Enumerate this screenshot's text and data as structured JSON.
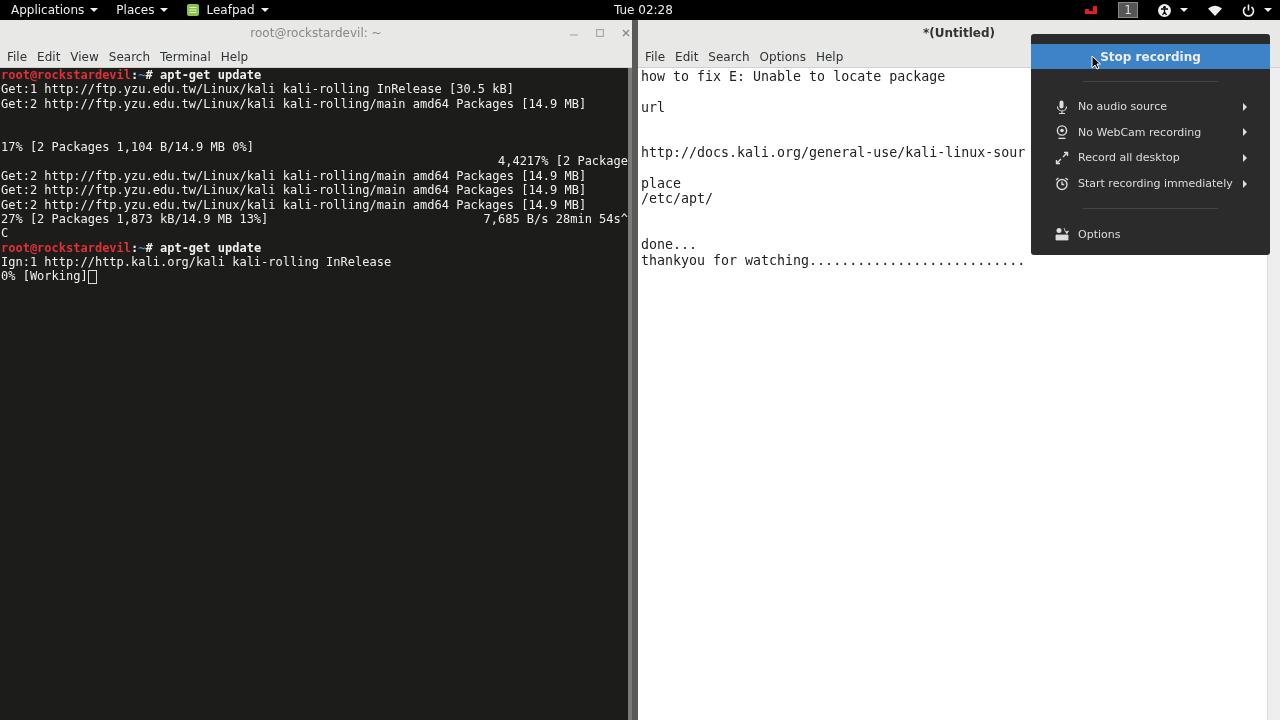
{
  "top_bar": {
    "menus": [
      {
        "label": "Applications",
        "kind": "plain"
      },
      {
        "label": "Places",
        "kind": "plain"
      },
      {
        "label": "Leafpad",
        "kind": "app"
      }
    ],
    "clock": "Tue 02:28",
    "workspace": "1"
  },
  "terminal": {
    "title": "root@rockstardevil: ~",
    "menu": [
      "File",
      "Edit",
      "View",
      "Search",
      "Terminal",
      "Help"
    ],
    "lines": [
      {
        "kind": "prompt",
        "user": "root@rockstardevil",
        "sep": ":",
        "path": "~",
        "command": "# apt-get update"
      },
      {
        "kind": "text",
        "text": "Get:1 http://ftp.yzu.edu.tw/Linux/kali kali-rolling InRelease [30.5 kB]"
      },
      {
        "kind": "text",
        "text": "Get:2 http://ftp.yzu.edu.tw/Linux/kali kali-rolling/main amd64 Packages [14.9 MB]"
      },
      {
        "kind": "blank"
      },
      {
        "kind": "blank"
      },
      {
        "kind": "text",
        "text": "17% [2 Packages 1,104 B/14.9 MB 0%]"
      },
      {
        "kind": "right",
        "text": "4,4217% [2 Package"
      },
      {
        "kind": "text",
        "text": "Get:2 http://ftp.yzu.edu.tw/Linux/kali kali-rolling/main amd64 Packages [14.9 MB]"
      },
      {
        "kind": "text",
        "text": "Get:2 http://ftp.yzu.edu.tw/Linux/kali kali-rolling/main amd64 Packages [14.9 MB]"
      },
      {
        "kind": "text",
        "text": "Get:2 http://ftp.yzu.edu.tw/Linux/kali kali-rolling/main amd64 Packages [14.9 MB]"
      },
      {
        "kind": "split",
        "left": "27% [2 Packages 1,873 kB/14.9 MB 13%]",
        "right": "7,685 B/s 28min 54s^"
      },
      {
        "kind": "text",
        "text": "C"
      },
      {
        "kind": "prompt",
        "user": "root@rockstardevil",
        "sep": ":",
        "path": "~",
        "command": "# apt-get update"
      },
      {
        "kind": "text",
        "text": "Ign:1 http://http.kali.org/kali kali-rolling InRelease"
      },
      {
        "kind": "cursor",
        "text": "0% [Working]"
      }
    ]
  },
  "leafpad": {
    "title": "*(Untitled)",
    "menu": [
      "File",
      "Edit",
      "Search",
      "Options",
      "Help"
    ],
    "lines": [
      {
        "kind": "text",
        "text": "how to fix E: Unable to locate package"
      },
      {
        "kind": "blank"
      },
      {
        "kind": "text",
        "text": "url"
      },
      {
        "kind": "blank"
      },
      {
        "kind": "blank"
      },
      {
        "kind": "text",
        "text": "http://docs.kali.org/general-use/kali-linux-sour"
      },
      {
        "kind": "blank"
      },
      {
        "kind": "text",
        "text": "place"
      },
      {
        "kind": "text",
        "text": "/etc/apt/"
      },
      {
        "kind": "blank"
      },
      {
        "kind": "blank"
      },
      {
        "kind": "text",
        "text": "done..."
      },
      {
        "kind": "text",
        "text": "thankyou for watching..........................."
      }
    ]
  },
  "recording_menu": {
    "items": [
      {
        "kind": "action",
        "label": "Stop recording",
        "selected": true
      },
      {
        "kind": "separator"
      },
      {
        "kind": "submenu",
        "label": "No audio source",
        "selected": false
      },
      {
        "kind": "submenu",
        "label": "No WebCam recording",
        "selected": false
      },
      {
        "kind": "submenu",
        "label": "Record all desktop",
        "selected": false
      },
      {
        "kind": "submenu",
        "label": "Start recording immediately",
        "selected": false
      },
      {
        "kind": "separator"
      },
      {
        "kind": "item",
        "label": "Options",
        "selected": false
      }
    ]
  }
}
